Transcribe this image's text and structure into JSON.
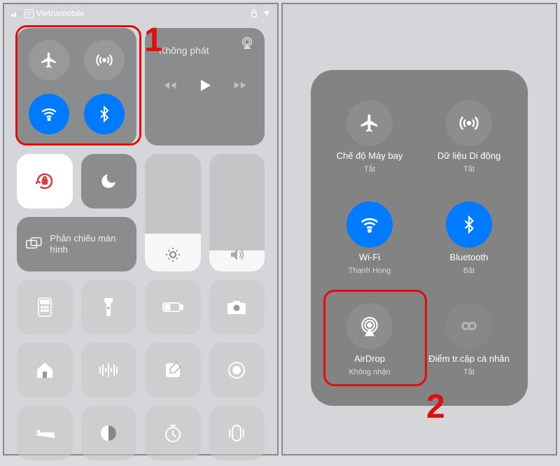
{
  "status_bar": {
    "carrier_indicator": "V",
    "carrier": "Vietnamobile"
  },
  "step1_label": "1",
  "step2_label": "2",
  "media": {
    "title": "Không phát"
  },
  "mirror": {
    "label": "Phản chiếu màn hình"
  },
  "expanded": {
    "airplane": {
      "label": "Chế độ Máy bay",
      "status": "Tắt"
    },
    "cellular": {
      "label": "Dữ liệu Di động",
      "status": "Tắt"
    },
    "wifi": {
      "label": "Wi-Fi",
      "status": "Thanh Hong"
    },
    "bluetooth": {
      "label": "Bluetooth",
      "status": "Bật"
    },
    "airdrop": {
      "label": "AirDrop",
      "status": "Không nhận"
    },
    "hotspot": {
      "label": "Điểm tr.cập cá nhân",
      "status": "Tắt"
    }
  }
}
